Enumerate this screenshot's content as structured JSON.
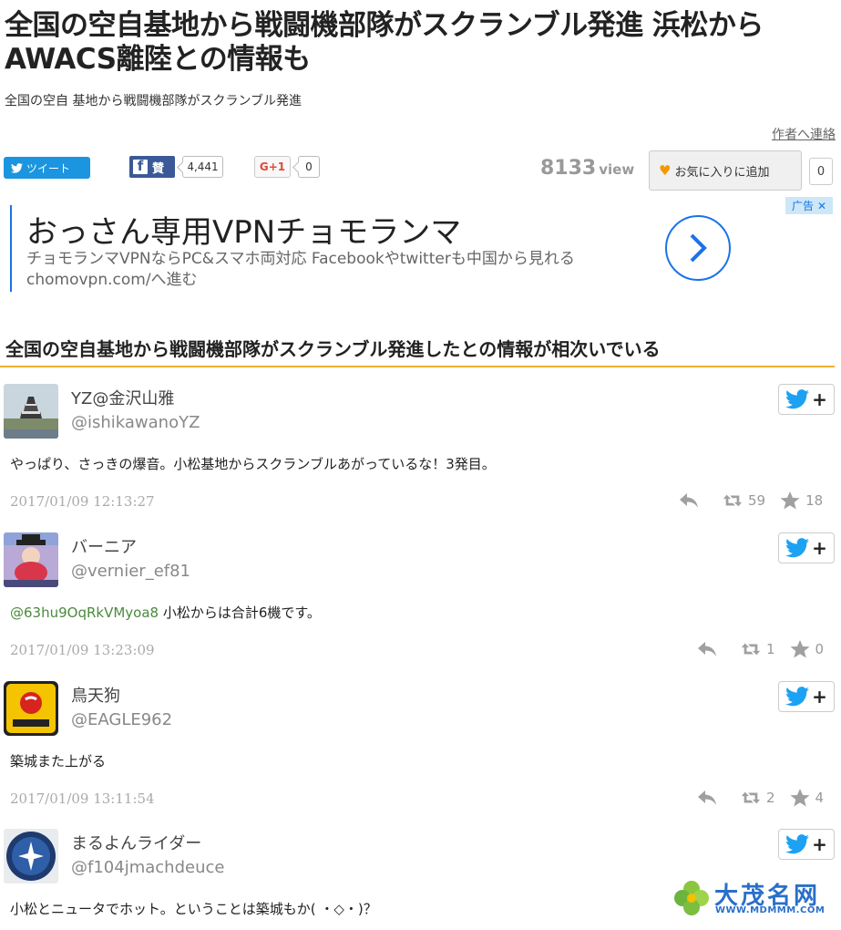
{
  "article": {
    "title": "全国の空自基地から戦闘機部隊がスクランブル発進 浜松からAWACS離陸との情報も",
    "subtitle": "全国の空自 基地から戦闘機部隊がスクランブル発進",
    "author_link": "作者へ連絡"
  },
  "share": {
    "tweet_label": "ツイート",
    "fb_label": "賛",
    "fb_count": "4,441",
    "gplus_label": "G+1",
    "gplus_count": "0",
    "views": "8133",
    "views_unit": "view",
    "favorite_label": "お気に入りに追加",
    "favorite_count": "0"
  },
  "ad": {
    "title": "おっさん専用VPNチョモランマ",
    "description": "チョモランマVPNならPC&スマホ両対応 Facebookやtwitterも中国から見れる chomovpn.com/へ進む",
    "label": "广告",
    "close": "✕"
  },
  "section": {
    "heading": "全国の空自基地から戦闘機部隊がスクランブル発進したとの情報が相次いでいる"
  },
  "tweets": [
    {
      "name": "YZ@金沢山雅",
      "handle": "@ishikawanoYZ",
      "mention": "",
      "text": "やっぱり、さっきの爆音。小松基地からスクランブルあがっているな！3発目。",
      "date": "2017/01/09 12:13:27",
      "retweets": "59",
      "likes": "18"
    },
    {
      "name": "バーニア",
      "handle": "@vernier_ef81",
      "mention": "@63hu9OqRkVMyoa8",
      "text": " 小松からは合計6機です。",
      "date": "2017/01/09 13:23:09",
      "retweets": "1",
      "likes": "0"
    },
    {
      "name": "鳥天狗",
      "handle": "@EAGLE962",
      "mention": "",
      "text": "築城また上がる",
      "date": "2017/01/09 13:11:54",
      "retweets": "2",
      "likes": "4"
    },
    {
      "name": "まるよんライダー",
      "handle": "@f104jmachdeuce",
      "mention": "",
      "text": "小松とニュータでホット。ということは築城もか( ・◇・)？"
    }
  ],
  "watermark": {
    "name": "大茂名网",
    "url": "WWW.MDMMM.COM"
  },
  "colors": {
    "twitter_blue": "#1b95e0",
    "facebook_blue": "#3b5998",
    "heading_underline": "#f0b034",
    "ad_blue": "#1a73e8"
  }
}
